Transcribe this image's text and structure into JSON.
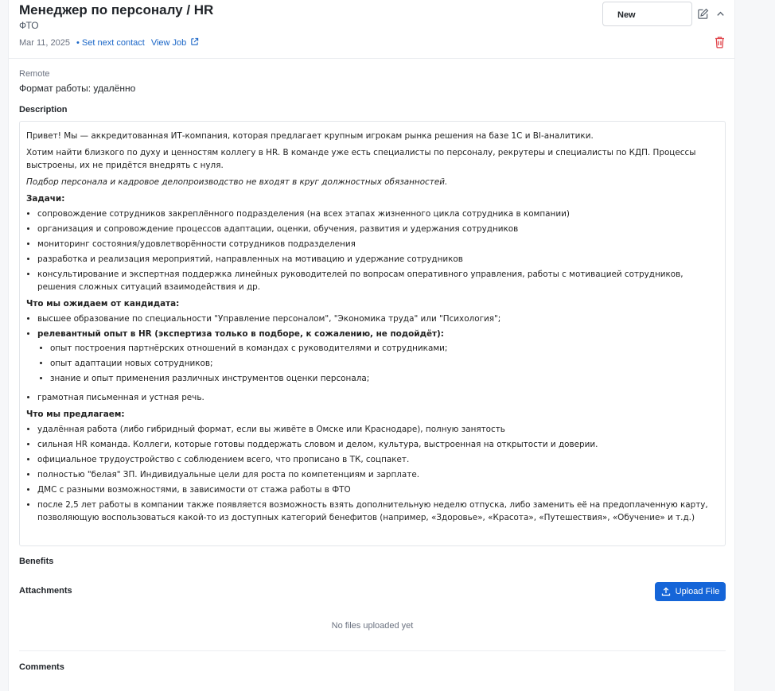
{
  "header": {
    "title": "Менеджер по персоналу / HR",
    "company": "ФТО",
    "date": "Mar 11, 2025",
    "set_next_contact": "• Set next contact",
    "view_job": "View Job",
    "status": "New",
    "icons": [
      "edit-icon",
      "chevron-up-icon",
      "trash-icon",
      "external-link-icon"
    ],
    "accent_color": "#1565d8",
    "delete_color": "#e0454b"
  },
  "work_format": {
    "label": "Remote",
    "value": "Формат работы: удалённо"
  },
  "description": {
    "label": "Description",
    "intro": "Привет! Мы — аккредитованная ИТ-компания, которая предлагает крупным игрокам рынка решения на базе 1С и BI-аналитики.",
    "team": "Хотим найти близкого по духу и ценностям коллегу в HR. В команде уже есть специалисты по персоналу, рекрутеры и специалисты по КДП. Процессы выстроены, их не придётся внедрять с нуля.",
    "note": "Подбор персонала и кадровое делопроизводство не входят в круг должностных обязанностей.",
    "tasks_heading": "Задачи:",
    "tasks": [
      "сопровождение сотрудников закреплённого подразделения (на всех этапах жизненного цикла сотрудника в компании)",
      "организация и сопровождение процессов адаптации, оценки, обучения, развития и удержания сотрудников",
      "мониторинг состояния/удовлетворённости сотрудников подразделения",
      "разработка и реализация мероприятий, направленных на мотивацию и удержание сотрудников",
      "консультирование и экспертная поддержка линейных руководителей по вопросам оперативного управления, работы с мотивацией сотрудников, решения сложных ситуаций взаимодействия и др."
    ],
    "expect_heading": "Что мы ожидаем от кандидата:",
    "expect_1": "высшее образование по специальности \"Управление персоналом\", \"Экономика труда\" или \"Психология\";",
    "expect_2": "релевантный опыт в HR (экспертиза только в подборе, к сожалению, не подойдёт):",
    "expect_sub": [
      "опыт построения партнёрских отношений в командах с руководителями и сотрудниками;",
      "опыт адаптации новых сотрудников;",
      "знание и опыт применения различных инструментов оценки персонала;"
    ],
    "expect_3": "грамотная письменная и устная речь.",
    "offer_heading": "Что мы предлагаем:",
    "offers": [
      "удалённая работа (либо гибридный формат, если вы живёте в Омске или Краснодаре), полную занятость",
      "сильная HR команда. Коллеги, которые готовы поддержать словом и делом, культура, выстроенная на открытости и доверии.",
      "официальное трудоустройство с соблюдением всего, что прописано в ТК, соцпакет.",
      "полностью \"белая\" ЗП. Индивидуальные цели для роста по компетенциям и зарплате.",
      "ДМС с разными возможностями, в зависимости от стажа работы в ФТО",
      "после 2,5 лет работы в компании также появляется возможность взять дополнительную неделю отпуска, либо заменить её на предоплаченную карту, позволяющую воспользоваться какой-то из доступных категорий бенефитов (например, «Здоровье», «Красота», «Путешествия», «Обучение» и т.д.)"
    ]
  },
  "benefits": {
    "label": "Benefits"
  },
  "attachments": {
    "label": "Attachments",
    "upload_label": "Upload File",
    "empty_text": "No files uploaded yet"
  },
  "comments": {
    "label": "Comments"
  }
}
